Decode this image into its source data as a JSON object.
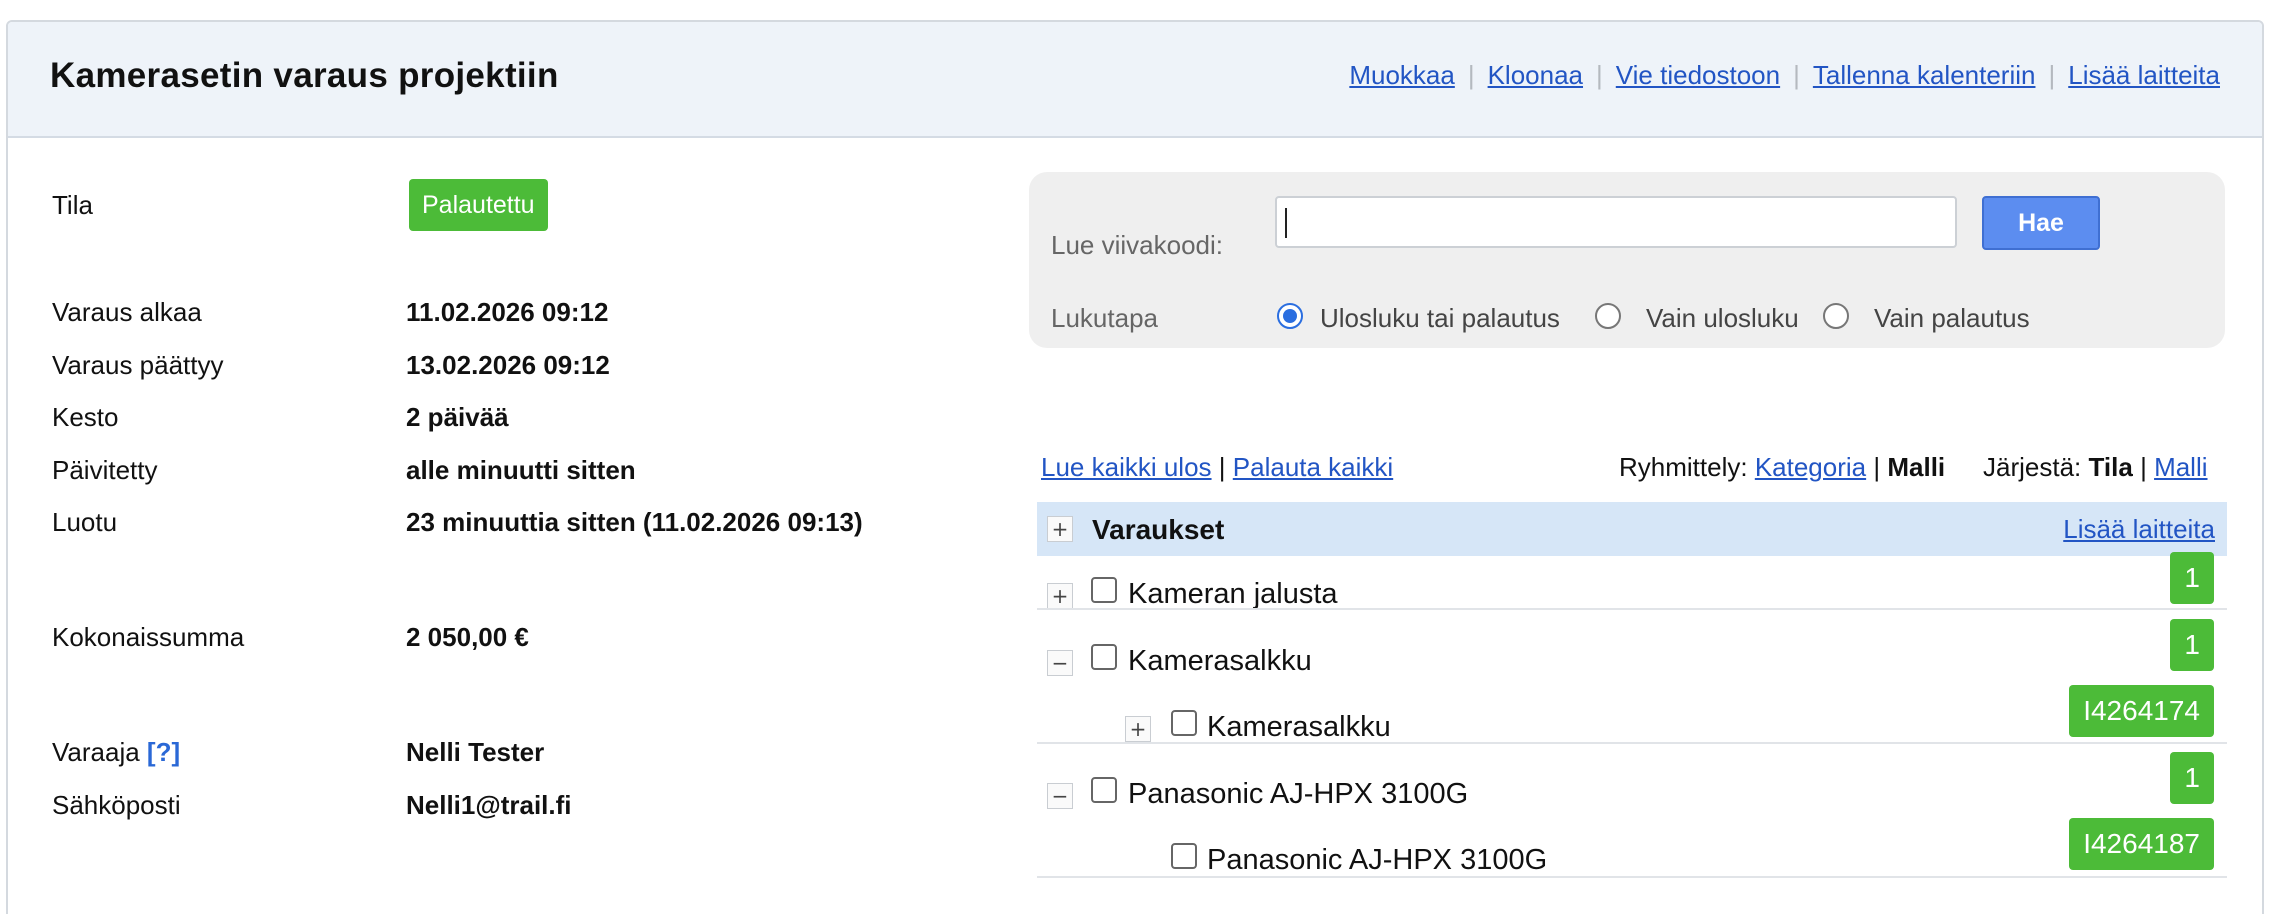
{
  "header": {
    "title": "Kamerasetin varaus projektiin",
    "actions": {
      "edit": "Muokkaa",
      "clone": "Kloonaa",
      "export": "Vie tiedostoon",
      "save_calendar": "Tallenna kalenteriin",
      "add_devices": "Lisää laitteita"
    },
    "separator": "|"
  },
  "details": {
    "status_label": "Tila",
    "status_value": "Palautettu",
    "start_label": "Varaus alkaa",
    "start_value": "11.02.2026 09:12",
    "end_label": "Varaus päättyy",
    "end_value": "13.02.2026 09:12",
    "duration_label": "Kesto",
    "duration_value": "2 päivää",
    "updated_label": "Päivitetty",
    "updated_value": "alle minuutti sitten",
    "created_label": "Luotu",
    "created_value": "23 minuuttia sitten (11.02.2026 09:13)",
    "total_label": "Kokonaissumma",
    "total_value": "2 050,00 €",
    "booker_label": "Varaaja",
    "booker_help": "[?]",
    "booker_value": "Nelli Tester",
    "email_label": "Sähköposti",
    "email_value": "Nelli1@trail.fi"
  },
  "scan": {
    "barcode_label": "Lue viivakoodi:",
    "barcode_value": "",
    "search_button": "Hae",
    "mode_label": "Lukutapa",
    "modes": [
      {
        "label": "Ulosluku tai palautus",
        "checked": true
      },
      {
        "label": "Vain ulosluku",
        "checked": false
      },
      {
        "label": "Vain palautus",
        "checked": false
      }
    ]
  },
  "list_toolbar": {
    "checkout_all": "Lue kaikki ulos",
    "pipe": "|",
    "return_all": "Palauta kaikki",
    "grouping_label": "Ryhmittely:",
    "grouping_category": "Kategoria",
    "grouping_model": "Malli",
    "sort_label": "Järjestä:",
    "sort_status": "Tila",
    "sort_model": "Malli"
  },
  "reservations": {
    "title": "Varaukset",
    "add_devices": "Lisää laitteita",
    "expand_symbol": "+",
    "collapse_symbol": "−",
    "items": [
      {
        "name": "Kameran jalusta",
        "badge": "1"
      },
      {
        "name": "Kamerasalkku",
        "badge": "1"
      },
      {
        "name": "Kamerasalkku",
        "badge": "I4264174"
      },
      {
        "name": "Panasonic AJ-HPX 3100G",
        "badge": "1"
      },
      {
        "name": "Panasonic AJ-HPX 3100G",
        "badge": "I4264187"
      }
    ]
  },
  "colors": {
    "badge_green": "#4cbb38",
    "link_blue": "#2255c4",
    "header_bg": "#eef3f9",
    "group_header_bg": "#d6e6f7",
    "button_blue": "#5c8df0"
  }
}
